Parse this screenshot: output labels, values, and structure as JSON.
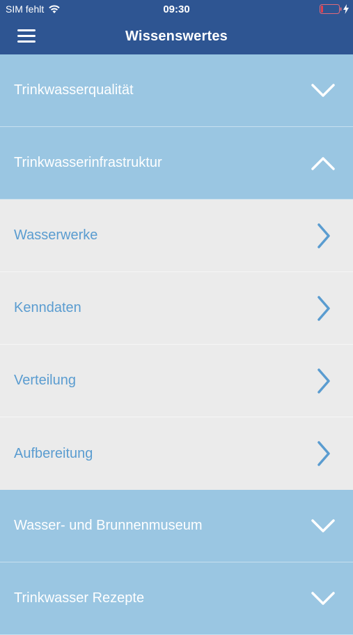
{
  "status": {
    "carrier": "SIM fehlt",
    "time": "09:30"
  },
  "nav": {
    "title": "Wissenswertes",
    "menu_icon": "hamburger-menu-icon"
  },
  "sections": [
    {
      "label": "Trinkwasserqualität",
      "expanded": false
    },
    {
      "label": "Trinkwasserinfrastruktur",
      "expanded": true,
      "items": [
        "Wasserwerke",
        "Kenndaten",
        "Verteilung",
        "Aufbereitung"
      ]
    },
    {
      "label": "Wasser- und Brunnenmuseum",
      "expanded": false
    },
    {
      "label": "Trinkwasser Rezepte",
      "expanded": false
    }
  ],
  "colors": {
    "header": "#2e5592",
    "section_bg": "#9ac6e2",
    "item_bg": "#ebebeb",
    "item_text": "#5a9cd0"
  }
}
